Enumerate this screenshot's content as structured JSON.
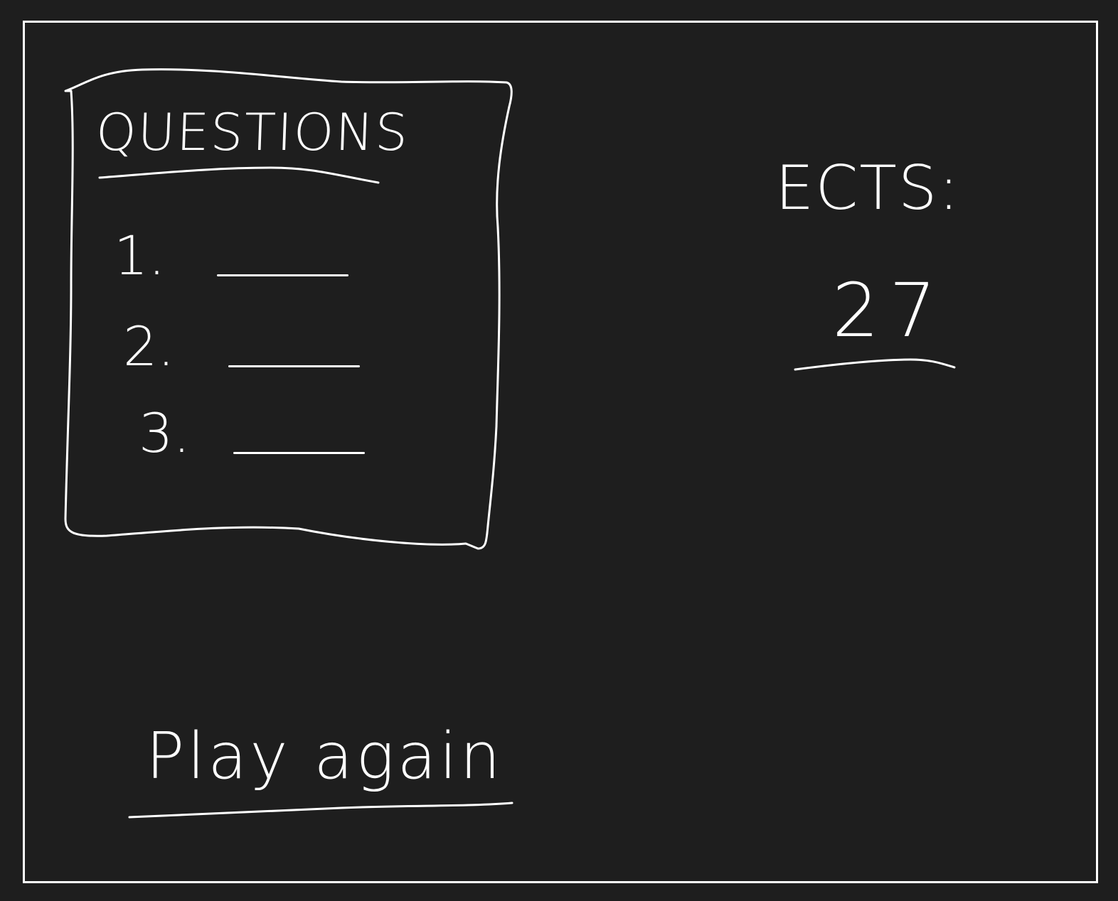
{
  "questions_panel": {
    "title": "QUESTIONS",
    "items": [
      {
        "number": "1."
      },
      {
        "number": "2."
      },
      {
        "number": "3."
      }
    ]
  },
  "score": {
    "label": "ECTS:",
    "value": "27"
  },
  "actions": {
    "play_again_label": "Play again"
  }
}
